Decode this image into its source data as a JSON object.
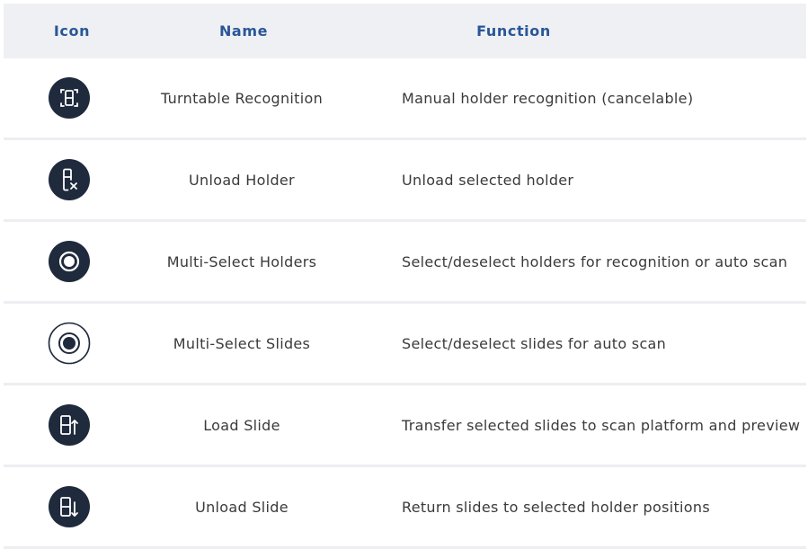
{
  "header": {
    "icon": "Icon",
    "name": "Name",
    "function": "Function"
  },
  "rows": [
    {
      "icon": "turntable-recognition-icon",
      "name": "Turntable Recognition",
      "function": "Manual holder recognition (cancelable)"
    },
    {
      "icon": "unload-holder-icon",
      "name": "Unload Holder",
      "function": "Unload selected holder"
    },
    {
      "icon": "multi-select-holders-icon",
      "name": "Multi-Select Holders",
      "function": "Select/deselect holders for recognition or auto scan"
    },
    {
      "icon": "multi-select-slides-icon",
      "name": "Multi-Select Slides",
      "function": "Select/deselect slides for auto scan"
    },
    {
      "icon": "load-slide-icon",
      "name": "Load Slide",
      "function": "Transfer selected slides to scan platform and preview"
    },
    {
      "icon": "unload-slide-icon",
      "name": "Unload Slide",
      "function": "Return slides to selected holder positions"
    }
  ],
  "colors": {
    "header_bg": "#eef0f3",
    "header_text": "#2a5698",
    "icon_dark": "#1f2a3c",
    "divider": "#eceef1"
  }
}
